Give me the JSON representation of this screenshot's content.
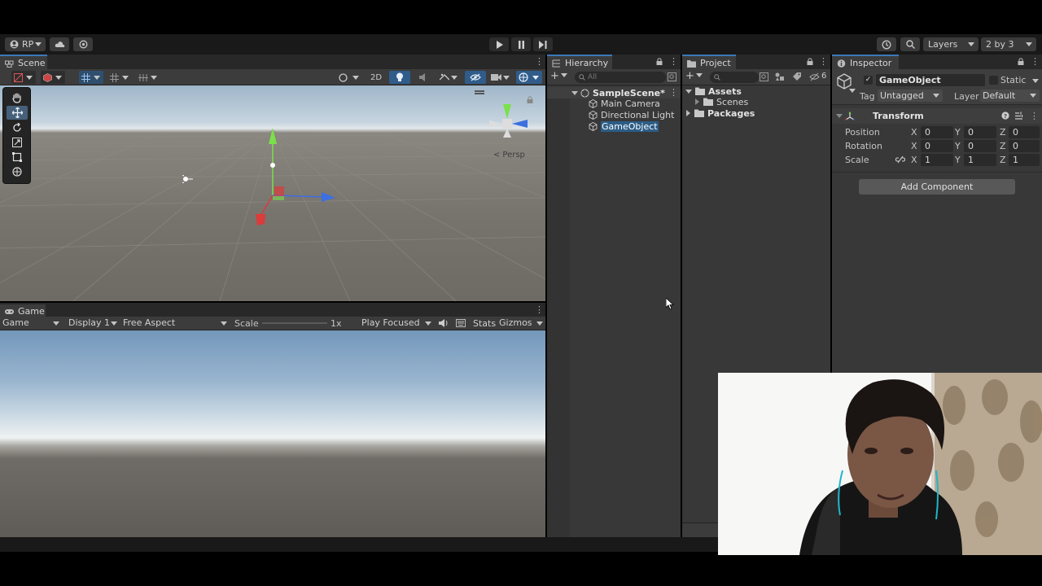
{
  "toolbar": {
    "account_label": "RP",
    "layers_label": "Layers",
    "layout_label": "2 by 3"
  },
  "scene": {
    "tab_label": "Scene",
    "mode_2d": "2D",
    "persp_label": "Persp"
  },
  "game": {
    "tab_label": "Game",
    "view_select": "Game",
    "display_select": "Display 1",
    "aspect_select": "Free Aspect",
    "scale_label": "Scale",
    "scale_value": "1x",
    "play_mode_select": "Play Focused",
    "stats_label": "Stats",
    "gizmos_label": "Gizmos"
  },
  "hierarchy": {
    "tab_label": "Hierarchy",
    "search_placeholder": "All",
    "scene_name": "SampleScene*",
    "items": [
      "Main Camera",
      "Directional Light",
      "GameObject"
    ],
    "selected_index": 2
  },
  "project": {
    "tab_label": "Project",
    "badge_count": "6",
    "folders": [
      {
        "name": "Assets",
        "bold": true
      },
      {
        "name": "Scenes",
        "bold": false
      },
      {
        "name": "Packages",
        "bold": true
      }
    ]
  },
  "inspector": {
    "tab_label": "Inspector",
    "object_name": "GameObject",
    "static_label": "Static",
    "tag_label": "Tag",
    "tag_value": "Untagged",
    "layer_label": "Layer",
    "layer_value": "Default",
    "component_title": "Transform",
    "rows": [
      {
        "label": "Position",
        "x": "0",
        "y": "0",
        "z": "0"
      },
      {
        "label": "Rotation",
        "x": "0",
        "y": "0",
        "z": "0"
      },
      {
        "label": "Scale",
        "x": "1",
        "y": "1",
        "z": "1"
      }
    ],
    "axis_x": "X",
    "axis_y": "Y",
    "axis_z": "Z",
    "add_component_label": "Add Component"
  },
  "colors": {
    "selection": "#2c5d87",
    "gizmo_x": "#db3b3b",
    "gizmo_y": "#7be04a",
    "gizmo_z": "#3c6fe0"
  }
}
